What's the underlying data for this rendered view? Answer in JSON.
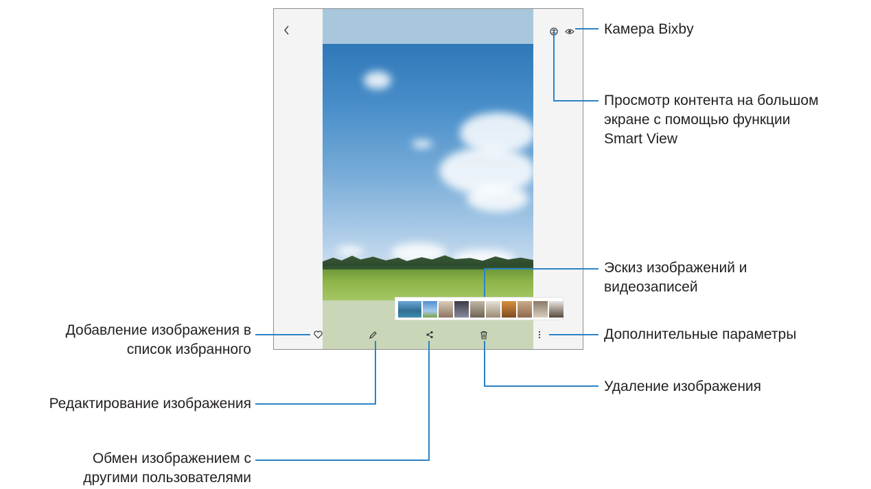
{
  "device": {
    "icons": {
      "back": "back-chevron-icon",
      "bixby_vision": "bixby-vision-icon",
      "smart_view": "eye-icon",
      "favorite": "heart-icon",
      "edit": "pencil-icon",
      "share": "share-icon",
      "delete": "trash-icon",
      "more": "more-options-icon"
    },
    "thumbnail_count": 11
  },
  "callouts": {
    "bixby_vision": "Камера Bixby",
    "smart_view": [
      "Просмотр контента на большом",
      "экране с помощью функции",
      "Smart View"
    ],
    "thumbnails": [
      "Эскиз изображений и",
      "видеозаписей"
    ],
    "more_options": "Дополнительные параметры",
    "delete": "Удаление изображения",
    "favorite": [
      "Добавление изображения в",
      "список избранного"
    ],
    "edit": "Редактирование изображения",
    "share": [
      "Обмен изображением с",
      "другими пользователями"
    ]
  },
  "colors": {
    "callout_line": "#2a82c6",
    "text": "#231f20",
    "frame": "#8d8d8d"
  }
}
